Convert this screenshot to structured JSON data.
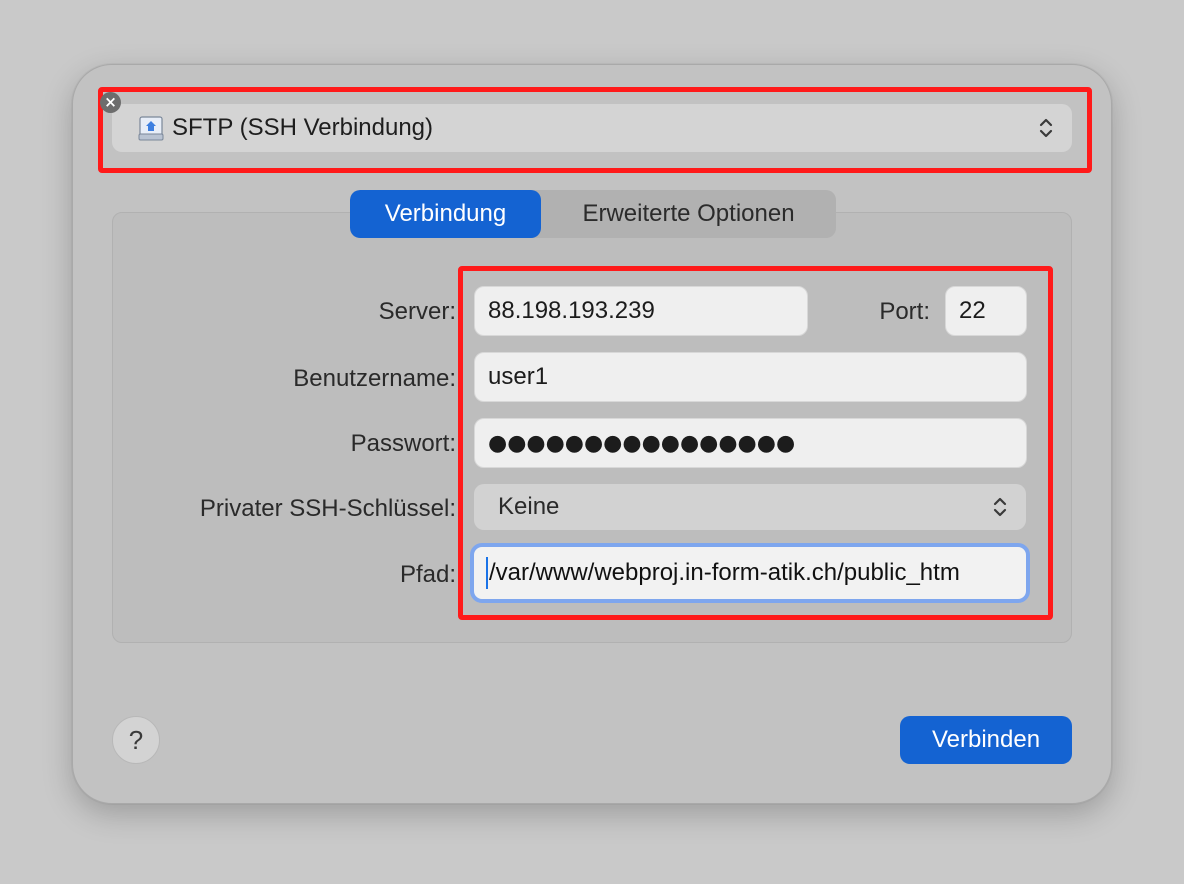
{
  "protocol": {
    "label": "SFTP (SSH Verbindung)",
    "icon": "network-drive-icon"
  },
  "tabs": [
    {
      "label": "Verbindung",
      "active": true
    },
    {
      "label": "Erweiterte Optionen",
      "active": false
    }
  ],
  "form": {
    "server_label": "Server:",
    "server_value": "88.198.193.239",
    "port_label": "Port:",
    "port_value": "22",
    "username_label": "Benutzername:",
    "username_value": "user1",
    "password_label": "Passwort:",
    "password_value": "●●●●●●●●●●●●●●●●",
    "ssh_key_label": "Privater SSH-Schlüssel:",
    "ssh_key_value": "Keine",
    "path_label": "Pfad:",
    "path_value": "/var/www/webproj.in-form-atik.ch/public_htm"
  },
  "footer": {
    "help_label": "?",
    "connect_label": "Verbinden"
  },
  "colors": {
    "accent": "#1463d2",
    "highlight": "#ff1a1a",
    "focus_ring": "#7ea6ee"
  }
}
